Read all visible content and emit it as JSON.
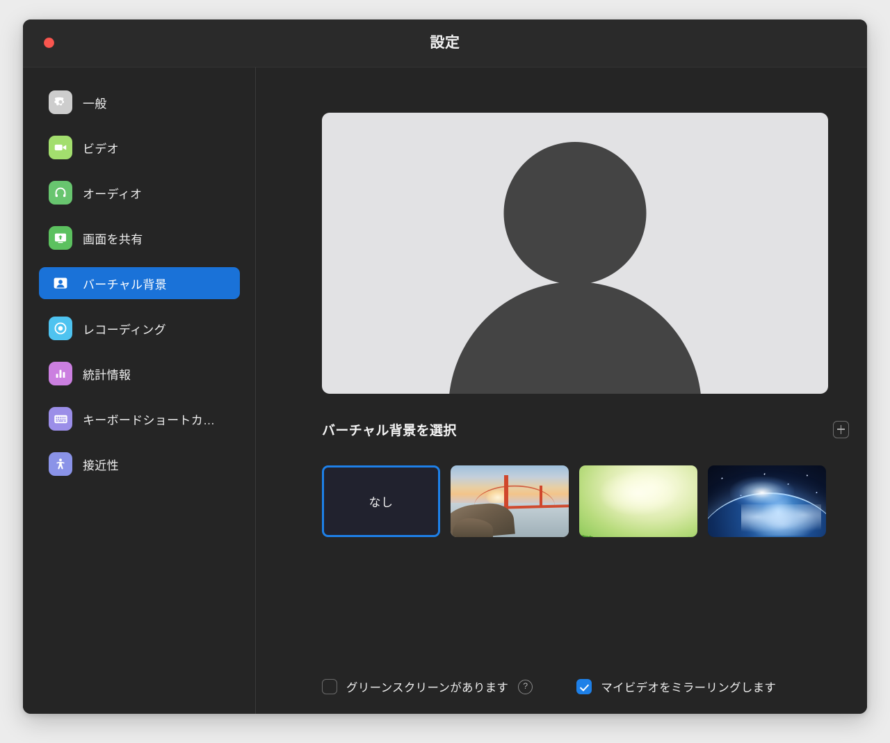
{
  "window": {
    "title": "設定",
    "close_button": "close",
    "accent_blue": "#1a72d8",
    "background": "#252525"
  },
  "sidebar": {
    "items": [
      {
        "label": "一般",
        "icon": "gear-icon",
        "color": "#cdcdcd",
        "selected": false
      },
      {
        "label": "ビデオ",
        "icon": "video-camera-icon",
        "color": "#a3de6e",
        "selected": false
      },
      {
        "label": "オーディオ",
        "icon": "headphones-icon",
        "color": "#68c56f",
        "selected": false
      },
      {
        "label": "画面を共有",
        "icon": "screen-share-icon",
        "color": "#5cc15f",
        "selected": false
      },
      {
        "label": "バーチャル背景",
        "icon": "person-badge-icon",
        "color": "#1a72d8",
        "selected": true
      },
      {
        "label": "レコーディング",
        "icon": "record-icon",
        "color": "#4ec3f0",
        "selected": false
      },
      {
        "label": "統計情報",
        "icon": "bar-chart-icon",
        "color": "#cb7fe0",
        "selected": false
      },
      {
        "label": "キーボードショートカ…",
        "icon": "keyboard-icon",
        "color": "#9b8ee8",
        "selected": false
      },
      {
        "label": "接近性",
        "icon": "accessibility-icon",
        "color": "#8a93e8",
        "selected": false
      }
    ]
  },
  "main": {
    "preview": {
      "name": "video-preview",
      "background_color": "#e2e2e4",
      "avatar_color": "#444444"
    },
    "section": {
      "title": "バーチャル背景を選択",
      "add_button_label": "+"
    },
    "backgrounds": [
      {
        "label": "なし",
        "kind": "none",
        "selected": true
      },
      {
        "label": "",
        "kind": "golden-gate-bridge",
        "selected": false
      },
      {
        "label": "",
        "kind": "grass",
        "selected": false
      },
      {
        "label": "",
        "kind": "earth-from-space",
        "selected": false
      }
    ],
    "options": [
      {
        "label": "グリーンスクリーンがあります",
        "checked": false,
        "help": "?"
      },
      {
        "label": "マイビデオをミラーリングします",
        "checked": true
      }
    ]
  }
}
